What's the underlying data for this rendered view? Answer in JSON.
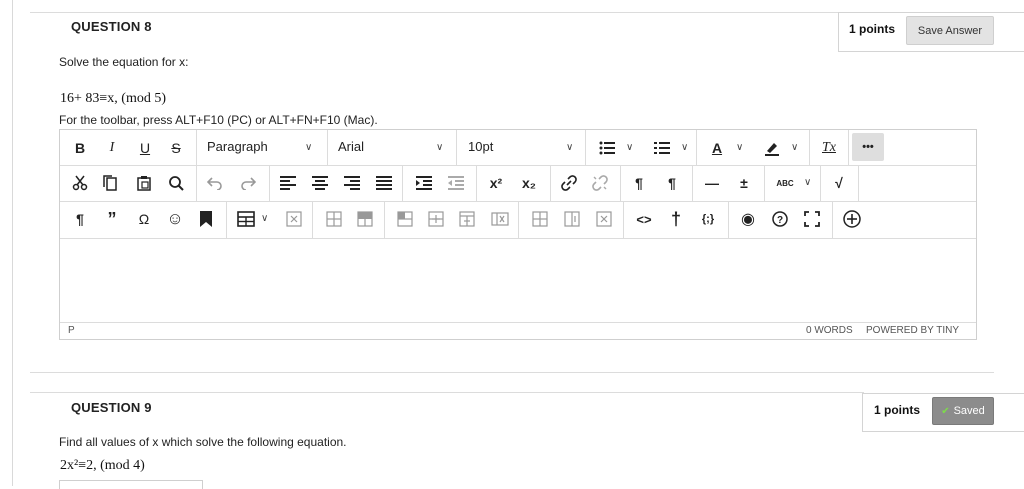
{
  "q8": {
    "title": "QUESTION 8",
    "points": "1 points",
    "save_label": "Save Answer",
    "prompt": "Solve the equation for x:",
    "equation": "16+ 83≡x, (mod 5)",
    "toolbar_hint": "For the toolbar, press ALT+F10 (PC) or ALT+FN+F10 (Mac).",
    "editor": {
      "paragraph": "Paragraph",
      "font": "Arial",
      "size": "10pt",
      "status_path": "P",
      "word_count": "0 WORDS",
      "powered_by": "POWERED BY TINY"
    }
  },
  "q9": {
    "title": "QUESTION 9",
    "points": "1 points",
    "saved_label": "Saved",
    "saved_check": "✔",
    "prompt": "Find all values of x which solve the following equation.",
    "equation": "2x²≡2, (mod 4)"
  },
  "icons": {
    "bold": "B",
    "italic": "I",
    "underline": "U",
    "strike": "S",
    "textcolor": "A",
    "clearformat": "Tx",
    "more": "•••",
    "superscript": "x²",
    "subscript": "x₂",
    "ltr": "¶",
    "rtl": "¶",
    "hr": "—",
    "plusminus": "±",
    "pilcrow": "¶",
    "quote": "”",
    "omega": "Ω",
    "emoji": "☺",
    "code": "<>",
    "accessibility": "†",
    "braces": "{;}",
    "preview": "◉",
    "help": "?",
    "add": "⊕",
    "spell": "ABC",
    "check": "√"
  },
  "colors": {
    "accent_saved": "#8c8c8c",
    "check": "#7ddc4a",
    "border": "#cfcfcf"
  }
}
